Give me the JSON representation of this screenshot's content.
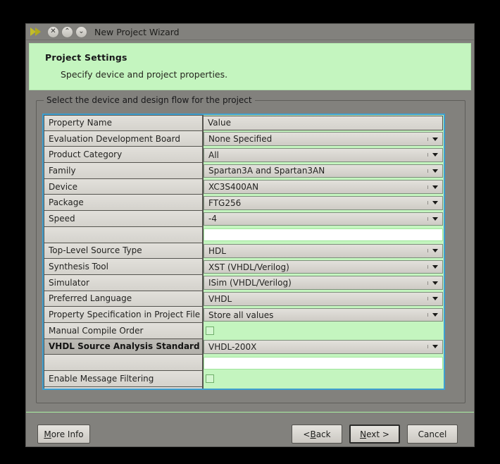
{
  "window": {
    "title": "New Project Wizard",
    "titlebar_icons": [
      "forward-arrow-icon",
      "close-icon",
      "minimize-icon",
      "maximize-icon"
    ],
    "close_glyph": "✕",
    "minimize_glyph": "⌃",
    "maximize_glyph": "⌄"
  },
  "banner": {
    "title": "Project Settings",
    "subtitle": "Specify device and project properties."
  },
  "group": {
    "legend": "Select the device and design flow for the project"
  },
  "table": {
    "columns": [
      "Property Name",
      "Value"
    ],
    "rows": [
      {
        "name": "Property Name",
        "value": "Value",
        "type": "header"
      },
      {
        "name": "Evaluation Development Board",
        "value": "None Specified",
        "type": "combo"
      },
      {
        "name": "Product Category",
        "value": "All",
        "type": "combo"
      },
      {
        "name": "Family",
        "value": "Spartan3A and Spartan3AN",
        "type": "combo"
      },
      {
        "name": "Device",
        "value": "XC3S400AN",
        "type": "combo"
      },
      {
        "name": "Package",
        "value": "FTG256",
        "type": "combo"
      },
      {
        "name": "Speed",
        "value": "-4",
        "type": "combo"
      },
      {
        "name": "",
        "value": "",
        "type": "text"
      },
      {
        "name": "Top-Level Source Type",
        "value": "HDL",
        "type": "combo"
      },
      {
        "name": "Synthesis Tool",
        "value": "XST (VHDL/Verilog)",
        "type": "combo"
      },
      {
        "name": "Simulator",
        "value": "ISim (VHDL/Verilog)",
        "type": "combo"
      },
      {
        "name": "Preferred Language",
        "value": "VHDL",
        "type": "combo"
      },
      {
        "name": "Property Specification in Project File",
        "value": "Store all values",
        "type": "combo"
      },
      {
        "name": "Manual Compile Order",
        "value": "",
        "type": "checkbox",
        "checked": false
      },
      {
        "name": "VHDL Source Analysis Standard",
        "value": "VHDL-200X",
        "type": "combo",
        "selected": true
      },
      {
        "name": "",
        "value": "",
        "type": "text"
      },
      {
        "name": "Enable Message Filtering",
        "value": "",
        "type": "checkbox",
        "checked": false
      },
      {
        "name": "",
        "value": "",
        "type": "blank"
      }
    ]
  },
  "buttons": {
    "more_info": {
      "pre": "",
      "mnemonic": "M",
      "post": "ore Info"
    },
    "back": {
      "pre": "< ",
      "mnemonic": "B",
      "post": "ack"
    },
    "next": {
      "pre": "",
      "mnemonic": "N",
      "post": "ext >"
    },
    "cancel": {
      "pre": "Cancel",
      "mnemonic": "",
      "post": ""
    }
  },
  "colors": {
    "banner_green": "#c4f5bf",
    "window_gray": "#82817d",
    "focus_blue": "#3d9fd1",
    "title_arrow": "#b8b322"
  }
}
